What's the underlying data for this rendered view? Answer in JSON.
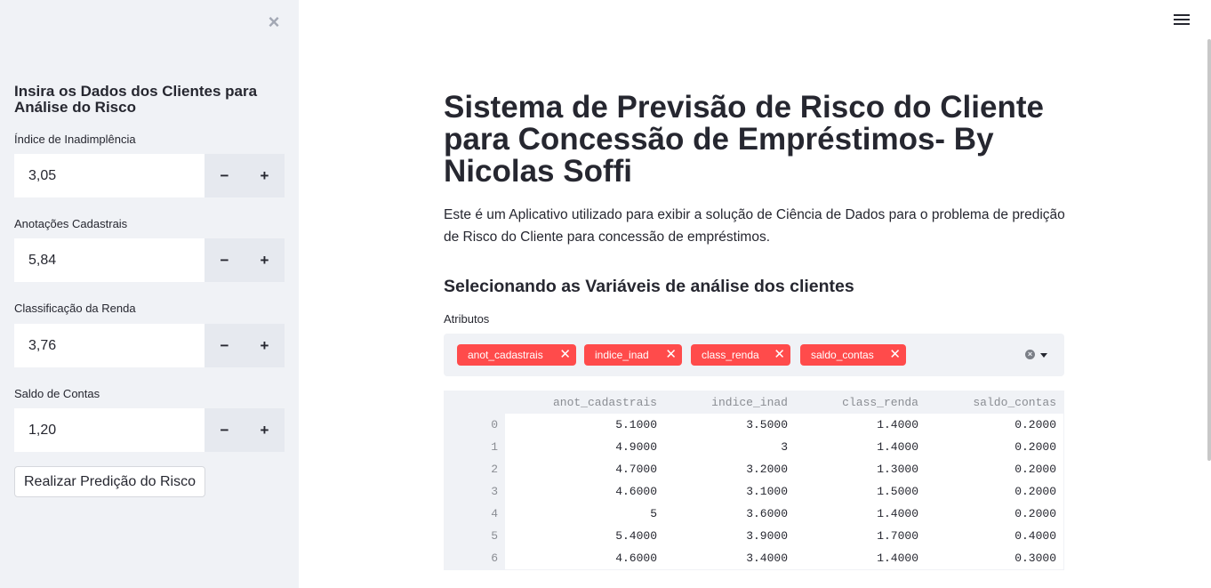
{
  "sidebar": {
    "close_glyph": "×",
    "title": "Insira os Dados dos Clientes para Análise do Risco",
    "inputs": [
      {
        "label": "Índice de Inadimplência",
        "value": "3,05",
        "minus": "−",
        "plus": "+"
      },
      {
        "label": "Anotações Cadastrais",
        "value": "5,84",
        "minus": "−",
        "plus": "+"
      },
      {
        "label": "Classificação da Renda",
        "value": "3,76",
        "minus": "−",
        "plus": "+"
      },
      {
        "label": "Saldo de Contas",
        "value": "1,20",
        "minus": "−",
        "plus": "+"
      }
    ],
    "predict_button": "Realizar Predição do Risco"
  },
  "main": {
    "menu_icon": "hamburger-icon",
    "title": "Sistema de Previsão de Risco do Cliente para Concessão de Empréstimos- By Nicolas Soffi",
    "description": "Este é um Aplicativo utilizado para exibir a solução de Ciência de Dados para o problema de predição de Risco do Cliente para concessão de empréstimos.",
    "section_title": "Selecionando as Variáveis de análise dos clientes",
    "multiselect": {
      "label": "Atributos",
      "tags": [
        "anot_cadastrais",
        "indice_inad",
        "class_renda",
        "saldo_contas"
      ],
      "tag_remove_glyph": "✕",
      "clear_glyph": "×",
      "tag_color": "#ff4b4b"
    },
    "table": {
      "columns": [
        "anot_cadastrais",
        "indice_inad",
        "class_renda",
        "saldo_contas"
      ],
      "rows": [
        {
          "index": "0",
          "cells": [
            "5.1000",
            "3.5000",
            "1.4000",
            "0.2000"
          ]
        },
        {
          "index": "1",
          "cells": [
            "4.9000",
            "3",
            "1.4000",
            "0.2000"
          ]
        },
        {
          "index": "2",
          "cells": [
            "4.7000",
            "3.2000",
            "1.3000",
            "0.2000"
          ]
        },
        {
          "index": "3",
          "cells": [
            "4.6000",
            "3.1000",
            "1.5000",
            "0.2000"
          ]
        },
        {
          "index": "4",
          "cells": [
            "5",
            "3.6000",
            "1.4000",
            "0.2000"
          ]
        },
        {
          "index": "5",
          "cells": [
            "5.4000",
            "3.9000",
            "1.7000",
            "0.4000"
          ]
        },
        {
          "index": "6",
          "cells": [
            "4.6000",
            "3.4000",
            "1.4000",
            "0.3000"
          ]
        }
      ]
    }
  }
}
